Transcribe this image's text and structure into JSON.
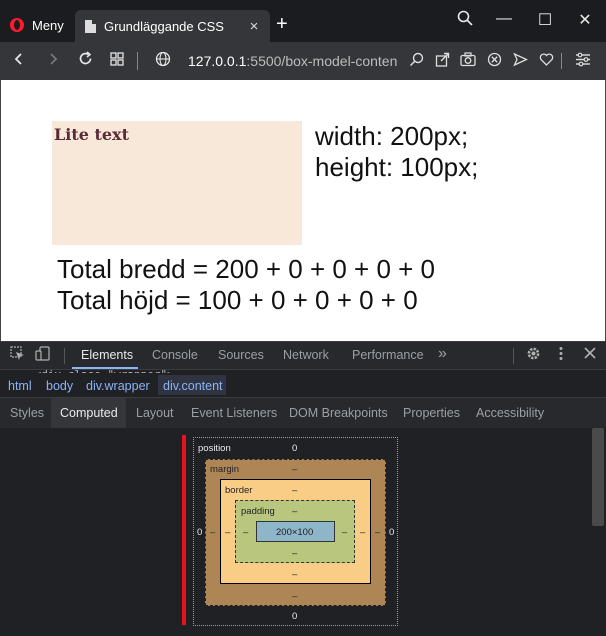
{
  "browser": {
    "menu_label": "Meny",
    "tab_title": "Grundläggande CSS",
    "tab_close": "×",
    "new_tab": "+",
    "window_controls": {
      "search": "⚲",
      "minimize": "—",
      "maximize": "☐",
      "close": "✕"
    },
    "url_host": "127.0.0.1",
    "url_path": ":5500/box-model-conten"
  },
  "page": {
    "content_text": "Lite text",
    "desc_width": "width: 200px;",
    "desc_height": "height: 100px;",
    "total_width": "Total bredd = 200 + 0 + 0 + 0 + 0",
    "total_height": "Total höjd = 100 + 0 + 0 + 0 + 0"
  },
  "devtools": {
    "tabs": [
      "Elements",
      "Console",
      "Sources",
      "Network",
      "Performance"
    ],
    "more": "»",
    "crumb_partial": "▾<div class=\"wrapper\">",
    "breadcrumbs": [
      "html",
      "body",
      "div.wrapper",
      "div.content"
    ],
    "subtabs": [
      "Styles",
      "Computed",
      "Layout",
      "Event Listeners",
      "DOM Breakpoints",
      "Properties",
      "Accessibility"
    ],
    "box_model": {
      "position_label": "position",
      "position_top": "0",
      "position_left": "0",
      "position_right": "0",
      "position_bottom": "0",
      "margin_label": "margin",
      "margin_top": "–",
      "margin_left": "–",
      "margin_right": "–",
      "margin_bottom": "–",
      "border_label": "border",
      "border_top": "–",
      "border_left": "–",
      "border_right": "–",
      "border_bottom": "–",
      "padding_label": "padding",
      "padding_top": "–",
      "padding_left": "–",
      "padding_right": "–",
      "padding_bottom": "–",
      "content_size": "200×100"
    }
  }
}
